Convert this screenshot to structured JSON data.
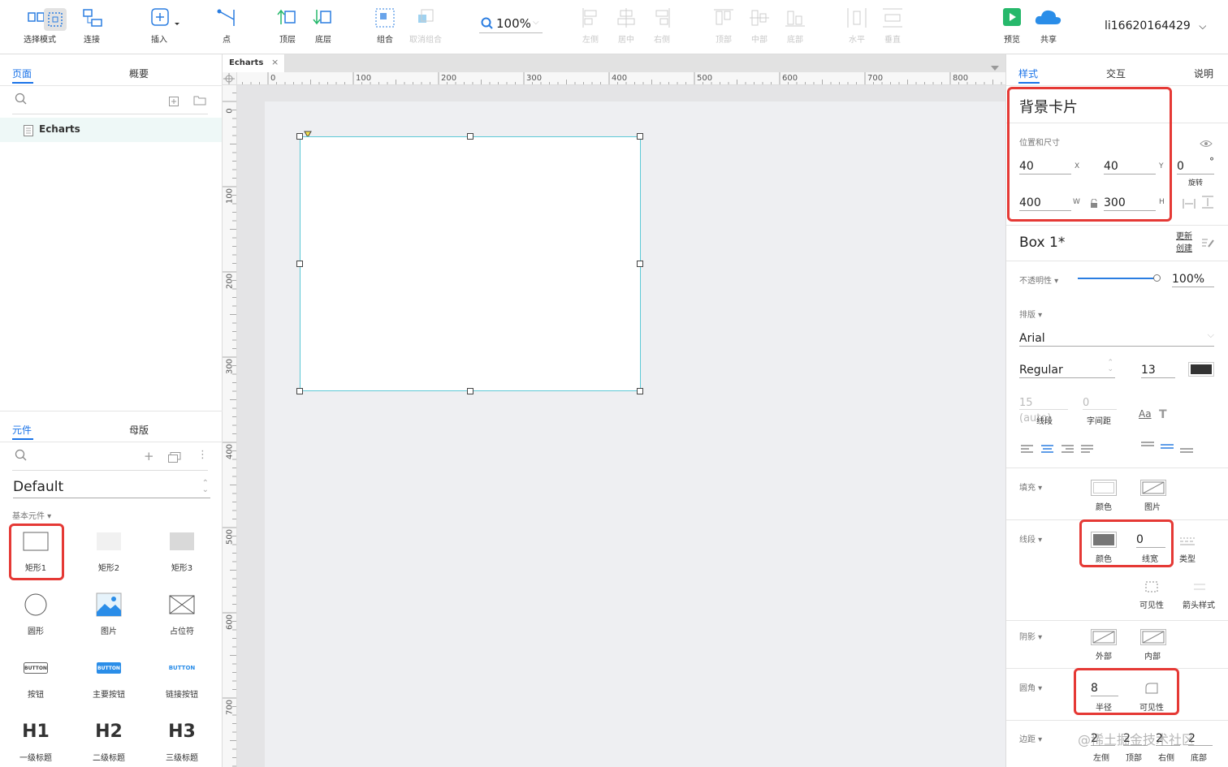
{
  "toolbar": {
    "select_mode": "选择模式",
    "connect": "连接",
    "insert": "插入",
    "point": "点",
    "top_layer": "顶层",
    "bottom_layer": "底层",
    "group": "组合",
    "ungroup": "取消组合",
    "zoom": "100%",
    "align_left": "左侧",
    "align_center": "居中",
    "align_right": "右侧",
    "align_top": "顶部",
    "align_middle": "中部",
    "align_bottom": "底部",
    "distribute_h": "水平",
    "distribute_v": "垂直",
    "preview": "预览",
    "share": "共享",
    "user": "li16620164429",
    "preview_color": "#26b86b",
    "share_color": "#2a8de8"
  },
  "left": {
    "tabs": [
      "页面",
      "概要"
    ],
    "page_item": "Echarts",
    "lib_tabs": [
      "元件",
      "母版"
    ],
    "library": "Default",
    "section": "基本元件",
    "components": [
      {
        "label": "矩形1",
        "icon": "rectangle-icon"
      },
      {
        "label": "矩形2",
        "icon": "rectangle-gray-icon"
      },
      {
        "label": "矩形3",
        "icon": "rectangle-dark-icon"
      },
      {
        "label": "圆形",
        "icon": "circle-icon"
      },
      {
        "label": "图片",
        "icon": "image-icon"
      },
      {
        "label": "占位符",
        "icon": "placeholder-icon"
      },
      {
        "label": "按钮",
        "icon": "button-icon",
        "mini": "BUTTON"
      },
      {
        "label": "主要按钮",
        "icon": "primary-button-icon",
        "mini": "BUTTON"
      },
      {
        "label": "链接按钮",
        "icon": "link-button-icon",
        "mini": "BUTTON"
      },
      {
        "label": "一级标题",
        "icon": "h1-icon",
        "mini": "H1"
      },
      {
        "label": "二级标题",
        "icon": "h2-icon",
        "mini": "H2"
      },
      {
        "label": "三级标题",
        "icon": "h3-icon",
        "mini": "H3"
      }
    ],
    "accent": "#1a73e8"
  },
  "canvas": {
    "tab_title": "Echarts",
    "h_ruler": [
      "0",
      "100",
      "200",
      "300",
      "400",
      "500",
      "600",
      "700",
      "800"
    ],
    "v_ruler": [
      "0",
      "100",
      "200",
      "300",
      "400",
      "500",
      "600",
      "700"
    ]
  },
  "right": {
    "tabs": [
      "样式",
      "交互",
      "说明"
    ],
    "component_name": "背景卡片",
    "pos_size_label": "位置和尺寸",
    "x": "40",
    "x_label": "X",
    "y": "40",
    "y_label": "Y",
    "rotation": "0",
    "rotation_unit": "°",
    "rotation_label": "旋转",
    "w": "400",
    "w_label": "W",
    "h": "300",
    "h_label": "H",
    "style_name": "Box 1*",
    "update": "更新",
    "create": "创建",
    "opacity_label": "不透明性",
    "opacity": "100%",
    "opacity_fraction": 1.0,
    "typography_label": "排版",
    "font": "Arial",
    "font_weight": "Regular",
    "font_size": "13",
    "line_height": "15 (auto)",
    "line_height_label": "线段",
    "letter_spacing": "0",
    "letter_spacing_label": "字间距",
    "fill_label": "填充",
    "fill_color": "颜色",
    "fill_image": "图片",
    "border_label": "线段",
    "border_color": "颜色",
    "border_width": "0",
    "border_width_label": "线宽",
    "border_type": "类型",
    "visibility": "可见性",
    "arrow_style": "箭头样式",
    "shadow_label": "阴影",
    "shadow_outer": "外部",
    "shadow_inner": "内部",
    "radius_label": "圆角",
    "radius": "8",
    "radius_sub": "半径",
    "radius_vis": "可见性",
    "padding_label": "边距",
    "padding": [
      "2",
      "2",
      "2",
      "2"
    ],
    "padding_sides": [
      "左侧",
      "顶部",
      "右侧",
      "底部"
    ],
    "watermark": "@稀土掘金技术社区"
  }
}
